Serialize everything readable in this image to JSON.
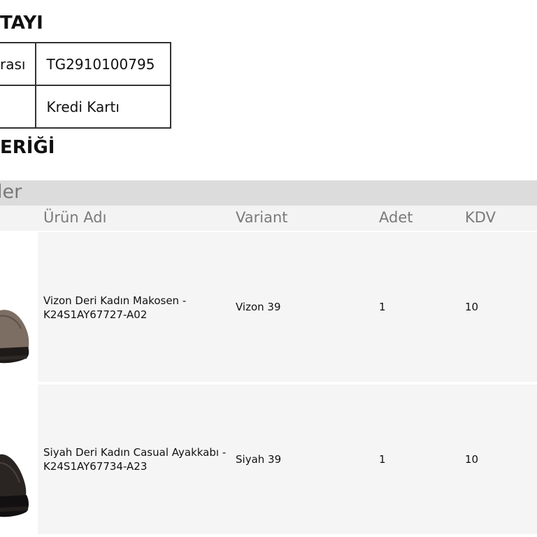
{
  "headings": {
    "detail": "TAYI",
    "content": "ERİĞİ"
  },
  "info_table": [
    {
      "key": "rası",
      "value": "TG2910100795"
    },
    {
      "key": "",
      "value": "Kredi Kartı"
    }
  ],
  "section_band": "ler",
  "columns": {
    "name": "Ürün Adı",
    "variant": "Variant",
    "qty": "Adet",
    "vat": "KDV"
  },
  "products": [
    {
      "name_line1": "Vizon Deri Kadın Makosen -",
      "name_line2": "K24S1AY67727-A02",
      "variant": "Vizon 39",
      "qty": "1",
      "vat": "10",
      "image": "brown-suede-loafer"
    },
    {
      "name_line1": "Siyah Deri Kadın Casual Ayakkabı -",
      "name_line2": "K24S1AY67734-A23",
      "variant": "Siyah 39",
      "qty": "1",
      "vat": "10",
      "image": "black-leather-shoe"
    }
  ]
}
